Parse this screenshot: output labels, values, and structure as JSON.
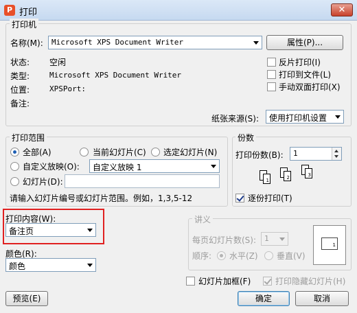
{
  "window": {
    "title": "打印",
    "icon": "P",
    "close": "✕"
  },
  "printer": {
    "legend": "打印机",
    "name_label": "名称(M):",
    "name_value": "Microsoft XPS Document Writer",
    "properties_button": "属性(P)...",
    "status_label": "状态:",
    "status_value": "空闲",
    "type_label": "类型:",
    "type_value": "Microsoft XPS Document Writer",
    "location_label": "位置:",
    "location_value": "XPSPort:",
    "comment_label": "备注:",
    "reverse_print": "反片打印(I)",
    "print_to_file": "打印到文件(L)",
    "manual_duplex": "手动双面打印(X)",
    "paper_source_label": "纸张来源(S):",
    "paper_source_value": "使用打印机设置"
  },
  "range": {
    "legend": "打印范围",
    "all": "全部(A)",
    "current_slide": "当前幻灯片(C)",
    "selected_slide": "选定幻灯片(N)",
    "custom_show": "自定义放映(O):",
    "custom_show_value": "自定义放映 1",
    "slides": "幻灯片(D):",
    "slides_value": "",
    "hint": "请输入幻灯片编号或幻灯片范围。例如，1,3,5-12"
  },
  "copies": {
    "legend": "份数",
    "count_label": "打印份数(B):",
    "count_value": "1",
    "collate": "逐份打印(T)",
    "collate_checked": true,
    "pages": [
      "1",
      "2",
      "3"
    ]
  },
  "content": {
    "label": "打印内容(W):",
    "value": "备注页"
  },
  "color": {
    "label": "颜色(R):",
    "value": "颜色"
  },
  "handouts": {
    "legend": "讲义",
    "per_page_label": "每页幻灯片数(S):",
    "per_page_value": "1",
    "order_label": "顺序:",
    "horizontal": "水平(Z)",
    "vertical": "垂直(V)",
    "preview_number": "1"
  },
  "options": {
    "frame_slides": "幻灯片加框(F)",
    "print_hidden": "打印隐藏幻灯片(H)"
  },
  "buttons": {
    "preview": "预览(E)",
    "ok": "确定",
    "cancel": "取消"
  }
}
